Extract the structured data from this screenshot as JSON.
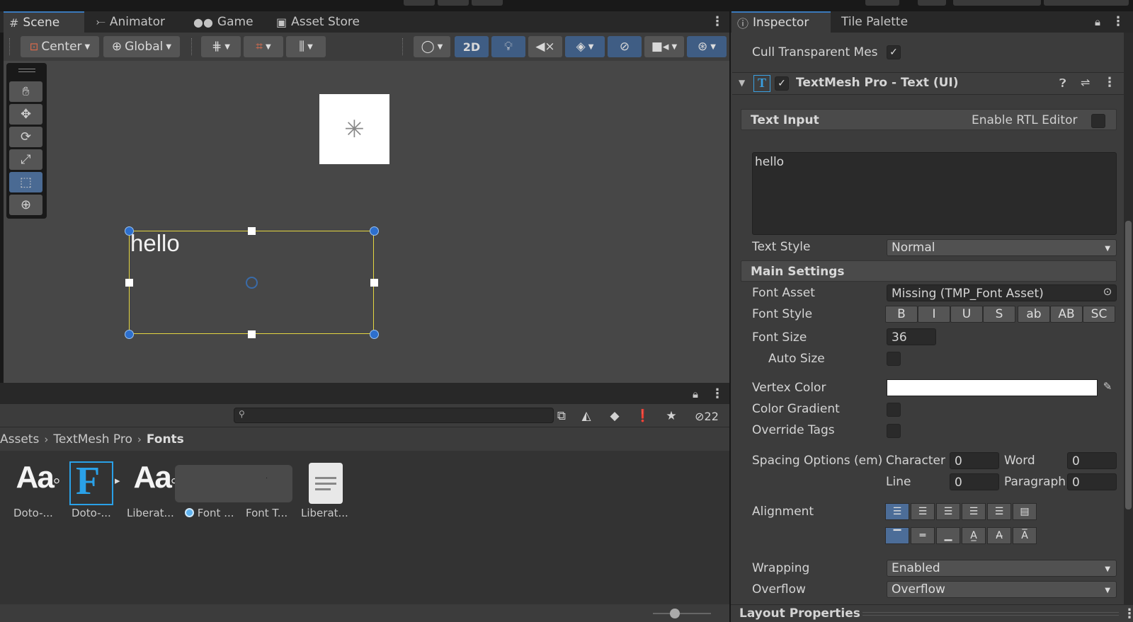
{
  "scene_tabs": [
    {
      "label": "Scene",
      "icon": "grid-icon"
    },
    {
      "label": "Animator",
      "icon": "animator-icon"
    },
    {
      "label": "Game",
      "icon": "gamepad-icon"
    },
    {
      "label": "Asset Store",
      "icon": "bag-icon"
    }
  ],
  "scene_toolbar": {
    "pivot_label": "Center",
    "space_label": "Global",
    "mode_2d_label": "2D"
  },
  "scene_view": {
    "text_object": "hello"
  },
  "project": {
    "hidden_count": "22",
    "breadcrumb": [
      "Assets",
      "TextMesh Pro",
      "Fonts"
    ],
    "assets": [
      {
        "label": "Doto-...",
        "icon": "font-asset-icon"
      },
      {
        "label": "Doto-...",
        "icon": "font-file-icon"
      },
      {
        "label": "Liberat...",
        "icon": "font-asset-icon"
      },
      {
        "label": "Font ...",
        "icon": "material-icon"
      },
      {
        "label": "Font T...",
        "icon": "texture-icon"
      },
      {
        "label": "Liberat...",
        "icon": "document-icon"
      }
    ]
  },
  "inspector": {
    "tabs": [
      "Inspector",
      "Tile Palette"
    ],
    "cull_label": "Cull Transparent Mes",
    "component_title": "TextMesh Pro - Text (UI)",
    "text_input": {
      "header": "Text Input",
      "rtl_label": "Enable RTL Editor",
      "value": "hello"
    },
    "text_style": {
      "label": "Text Style",
      "value": "Normal"
    },
    "main_settings": "Main Settings",
    "font_asset": {
      "label": "Font Asset",
      "value": "Missing (TMP_Font Asset)"
    },
    "font_style": {
      "label": "Font Style",
      "buttons": [
        "B",
        "I",
        "U",
        "S",
        "ab",
        "AB",
        "SC"
      ]
    },
    "font_size": {
      "label": "Font Size",
      "value": "36"
    },
    "auto_size": "Auto Size",
    "vertex_color": {
      "label": "Vertex Color",
      "value": "#ffffff"
    },
    "color_gradient": "Color Gradient",
    "override_tags": "Override Tags",
    "spacing": {
      "label": "Spacing Options (em)",
      "character_label": "Character",
      "character_value": "0",
      "word_label": "Word",
      "word_value": "0",
      "line_label": "Line",
      "line_value": "0",
      "paragraph_label": "Paragraph",
      "paragraph_value": "0"
    },
    "alignment": "Alignment",
    "wrapping": {
      "label": "Wrapping",
      "value": "Enabled"
    },
    "overflow": {
      "label": "Overflow",
      "value": "Overflow"
    },
    "layout_properties": "Layout Properties"
  },
  "colors": {
    "selection_accent": "#3a79bb",
    "rect_outline": "#e4d641",
    "handle_blue": "#2d6fcd"
  }
}
